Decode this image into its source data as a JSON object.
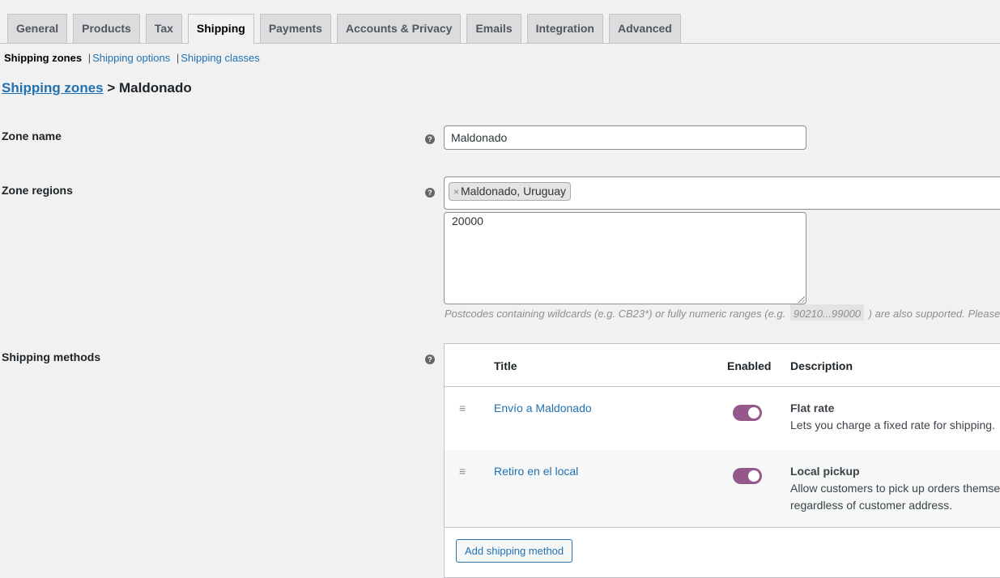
{
  "tabs": [
    {
      "label": "General",
      "active": false
    },
    {
      "label": "Products",
      "active": false
    },
    {
      "label": "Tax",
      "active": false
    },
    {
      "label": "Shipping",
      "active": true
    },
    {
      "label": "Payments",
      "active": false
    },
    {
      "label": "Accounts & Privacy",
      "active": false
    },
    {
      "label": "Emails",
      "active": false
    },
    {
      "label": "Integration",
      "active": false
    },
    {
      "label": "Advanced",
      "active": false
    }
  ],
  "subnav": {
    "current": "Shipping zones",
    "links": [
      "Shipping options",
      "Shipping classes"
    ],
    "separator": "|"
  },
  "heading": {
    "link": "Shipping zones",
    "separator": ">",
    "zone": "Maldonado"
  },
  "form": {
    "zone_name_label": "Zone name",
    "zone_name_value": "Maldonado",
    "zone_regions_label": "Zone regions",
    "region_chips": [
      {
        "remove": "×",
        "label": "Maldonado, Uruguay"
      }
    ],
    "postcodes_value": "20000",
    "postcodes_help_before": "Postcodes containing wildcards (e.g. CB23*) or fully numeric ranges (e.g.",
    "postcodes_help_code": "90210...99000",
    "postcodes_help_after": ") are also supported. Please see",
    "shipping_methods_label": "Shipping methods",
    "help_icon": "?"
  },
  "methods_table": {
    "columns": [
      "Title",
      "Enabled",
      "Description"
    ],
    "rows": [
      {
        "drag_icon": "≡",
        "title": "Envío a Maldonado",
        "enabled": true,
        "method_name": "Flat rate",
        "description_lines": [
          "Lets you charge a fixed rate for shipping."
        ]
      },
      {
        "drag_icon": "≡",
        "title": "Retiro en el local",
        "enabled": true,
        "method_name": "Local pickup",
        "description_lines": [
          "Allow customers to pick up orders themselves.",
          "regardless of customer address."
        ]
      }
    ],
    "add_button": "Add shipping method"
  },
  "colors": {
    "accent_link": "#2271b1",
    "toggle_on": "#96588a",
    "background": "#f1f1f1"
  }
}
